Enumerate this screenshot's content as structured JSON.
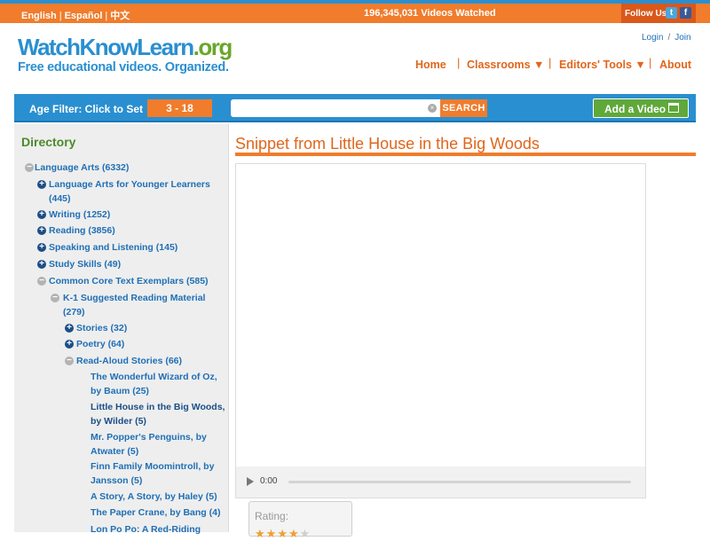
{
  "topbar": {
    "languages": [
      "English",
      "Español",
      "中文"
    ],
    "videos_watched": "196,345,031 Videos Watched",
    "follow_label": "Follow Us",
    "twitter_glyph": "t",
    "facebook_glyph": "f"
  },
  "logo": {
    "main": "WatchKnowLearn",
    "tld": ".org",
    "tagline": "Free educational videos. Organized."
  },
  "account": {
    "login": "Login",
    "join": "Join",
    "separator": "/"
  },
  "nav": {
    "items": [
      {
        "label": "Home"
      },
      {
        "label": "Classrooms ▼"
      },
      {
        "label": "Editors' Tools ▼"
      },
      {
        "label": "About"
      }
    ],
    "separator": "|"
  },
  "toolbar": {
    "age_label": "Age Filter: Click to Set",
    "age_range": "3 - 18",
    "search_value": "",
    "search_button": "SEARCH",
    "add_video": "Add a Video"
  },
  "sidebar": {
    "title": "Directory",
    "tree": [
      {
        "icon": "minus",
        "lines": [
          "Language Arts (6332)"
        ]
      },
      {
        "icon": "plus",
        "lines": [
          "Language Arts for Younger Learners",
          "(445)"
        ]
      },
      {
        "icon": "plus",
        "lines": [
          "Writing (1252)"
        ]
      },
      {
        "icon": "plus",
        "lines": [
          "Reading (3856)"
        ]
      },
      {
        "icon": "plus",
        "lines": [
          "Speaking and Listening (145)"
        ]
      },
      {
        "icon": "plus",
        "lines": [
          "Study Skills (49)"
        ]
      },
      {
        "icon": "minus",
        "lines": [
          "Common Core Text Exemplars (585)"
        ]
      },
      {
        "icon": "minus",
        "lines": [
          "K-1 Suggested Reading Material",
          "(279)"
        ]
      },
      {
        "icon": "plus",
        "lines": [
          "Stories (32)"
        ]
      },
      {
        "icon": "plus",
        "lines": [
          "Poetry (64)"
        ]
      },
      {
        "icon": "minus",
        "lines": [
          "Read-Aloud Stories (66)"
        ]
      },
      {
        "icon": "none",
        "lines": [
          "The Wonderful Wizard of Oz,",
          "by Baum (25)"
        ]
      },
      {
        "icon": "none",
        "lines": [
          "Little House in the Big Woods,",
          "by Wilder (5)"
        ],
        "current": true
      },
      {
        "icon": "none",
        "lines": [
          "Mr. Popper's Penguins, by",
          "Atwater (5)"
        ]
      },
      {
        "icon": "none",
        "lines": [
          "Finn Family Moomintroll, by",
          "Jansson (5)"
        ]
      },
      {
        "icon": "none",
        "lines": [
          "A Story, A Story, by Haley (5)"
        ]
      },
      {
        "icon": "none",
        "lines": [
          "The Paper Crane, by Bang (4)"
        ]
      },
      {
        "icon": "none",
        "lines": [
          "Lon Po Po: A Red-Riding"
        ]
      }
    ]
  },
  "main": {
    "title": "Snippet from Little House in the Big Woods",
    "player": {
      "time": "0:00",
      "progress": 0
    },
    "rating": {
      "label": "Rating:",
      "stars_on": 4,
      "stars_total": 5
    }
  },
  "colors": {
    "orange": "#f07c2c",
    "blue": "#2a8fd0",
    "green": "#5fa83a",
    "link": "#1f6fb5"
  }
}
